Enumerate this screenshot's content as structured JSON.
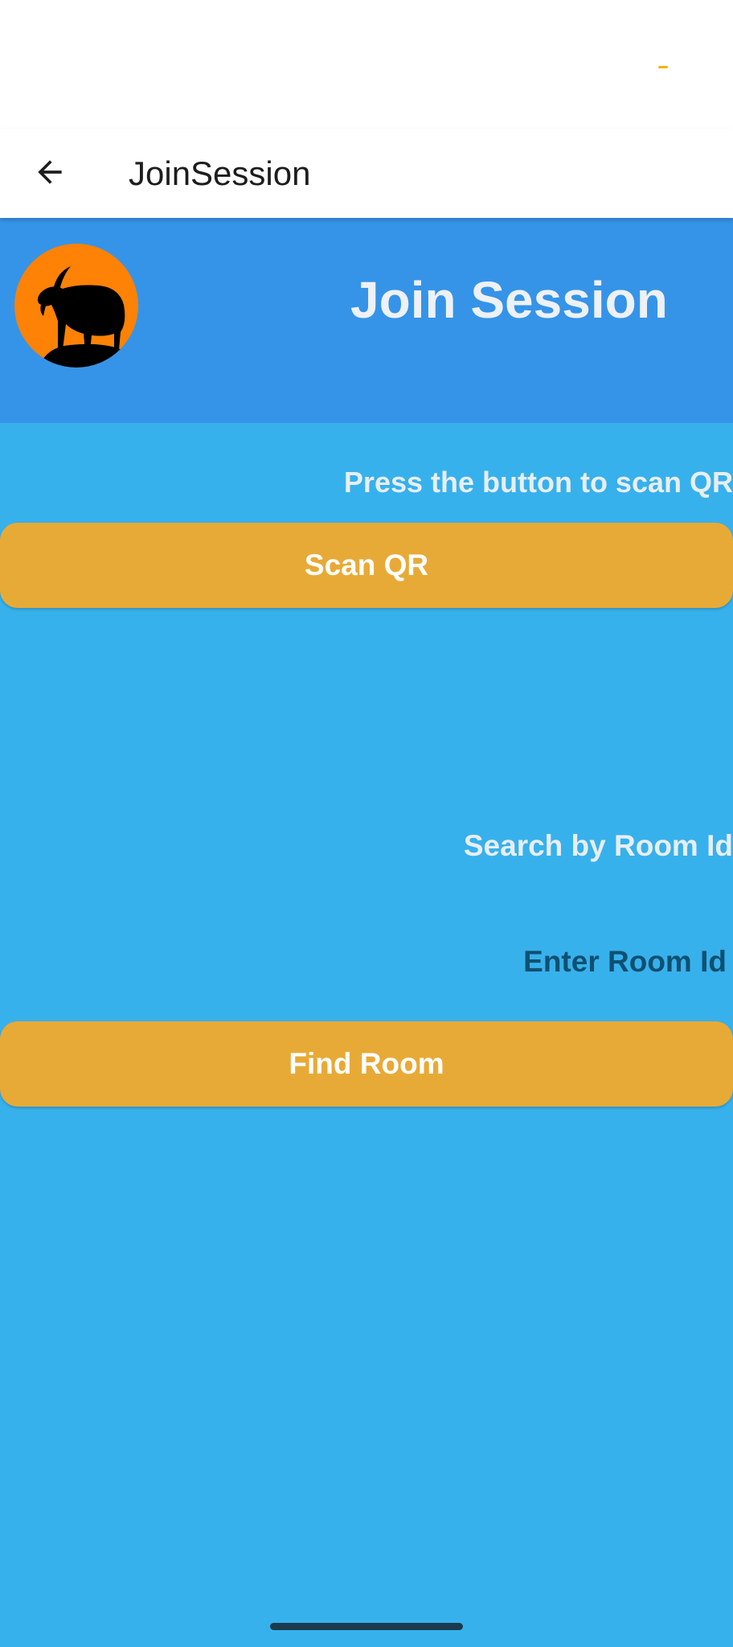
{
  "app_bar": {
    "title": "JoinSession",
    "back_icon": "arrow-left-icon"
  },
  "header": {
    "logo_icon": "goat-silhouette-icon",
    "title": "Join Session"
  },
  "qr_section": {
    "hint": "Press the button to scan QR",
    "button_label": "Scan QR"
  },
  "room_section": {
    "label": "Search by Room Id",
    "input_placeholder": "Enter Room Id",
    "input_value": "",
    "button_label": "Find Room"
  },
  "colors": {
    "background": "#37b1ec",
    "header_band": "#3594e8",
    "button": "#e8aa36",
    "logo_circle": "#fd8205"
  }
}
